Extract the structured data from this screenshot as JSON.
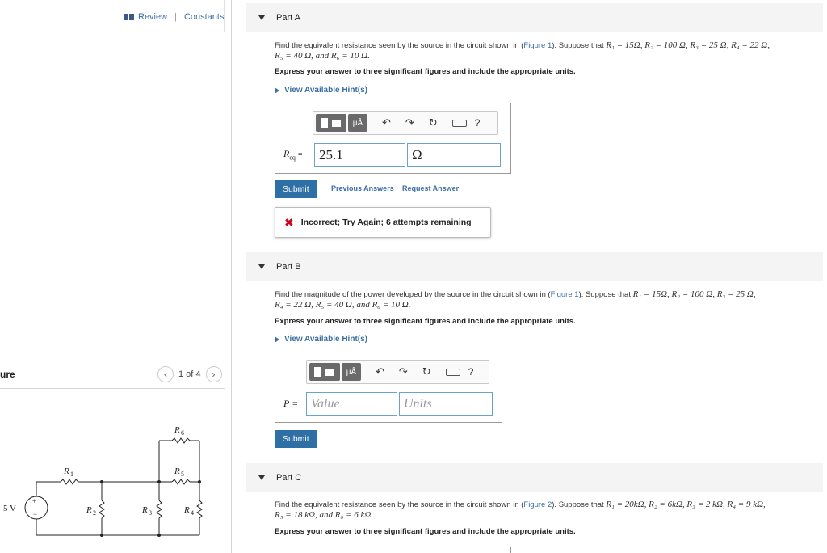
{
  "top_nav": {
    "review": "Review",
    "separator": "|",
    "constants": "Constants"
  },
  "figure": {
    "title": "ure",
    "counter": "1 of 4",
    "prev": "‹",
    "next": "›",
    "labels": {
      "R1": "R",
      "R2": "R",
      "R3": "R",
      "R4": "R",
      "R5": "R",
      "R6": "R",
      "source": "5 V",
      "plus": "+",
      "minus": "−"
    },
    "subs": {
      "R1": "1",
      "R2": "2",
      "R3": "3",
      "R4": "4",
      "R5": "5",
      "R6": "6"
    }
  },
  "partA": {
    "title": "Part A",
    "q_prefix": "Find the equivalent resistance seen by the source in the circuit shown in (",
    "fig_link": "Figure 1",
    "q_mid": "). Suppose that ",
    "q_values_1": "R₁ = 15Ω, R₂ = 100 Ω, R₃ = 25 Ω, R₄ = 22 Ω,",
    "q_values_2": "R₅ = 40 Ω, and R₆ = 10 Ω.",
    "instruction": "Express your answer to three significant figures and include the appropriate units.",
    "hint": "View Available Hint(s)",
    "var_label": "R",
    "var_sub": "eq",
    "var_eq": "=",
    "value": "25.1",
    "units": "Ω",
    "submit": "Submit",
    "previous_answers": "Previous Answers",
    "request_answer": "Request Answer",
    "feedback": "Incorrect; Try Again; 6 attempts remaining"
  },
  "partB": {
    "title": "Part B",
    "q_prefix": "Find the magnitude of the power developed by the source in the circuit shown in (",
    "fig_link": "Figure 1",
    "q_mid": "). Suppose that ",
    "q_values_1": "R₁ = 15Ω, R₂ = 100 Ω, R₃ = 25 Ω,",
    "q_values_2": "R₄ = 22 Ω, R₅ = 40 Ω, and R₆ = 10 Ω.",
    "instruction": "Express your answer to three significant figures and include the appropriate units.",
    "hint": "View Available Hint(s)",
    "var_label": "P =",
    "value_placeholder": "Value",
    "units_placeholder": "Units",
    "submit": "Submit"
  },
  "partC": {
    "title": "Part C",
    "q_prefix": "Find the equivalent resistance seen by the source in the circuit shown in (",
    "fig_link": "Figure 2",
    "q_mid": "). Suppose that ",
    "q_values_1": "R₁ = 20kΩ, R₂ = 6kΩ, R₃ = 2 kΩ, R₄ = 9 kΩ,",
    "q_values_2": "R₅ = 18 kΩ, and R₆ = 6 kΩ.",
    "instruction": "Express your answer to three significant figures and include the appropriate units."
  },
  "toolbar": {
    "mu": "μÅ",
    "undo": "↶",
    "redo": "↷",
    "reset": "↻",
    "help": "?"
  }
}
